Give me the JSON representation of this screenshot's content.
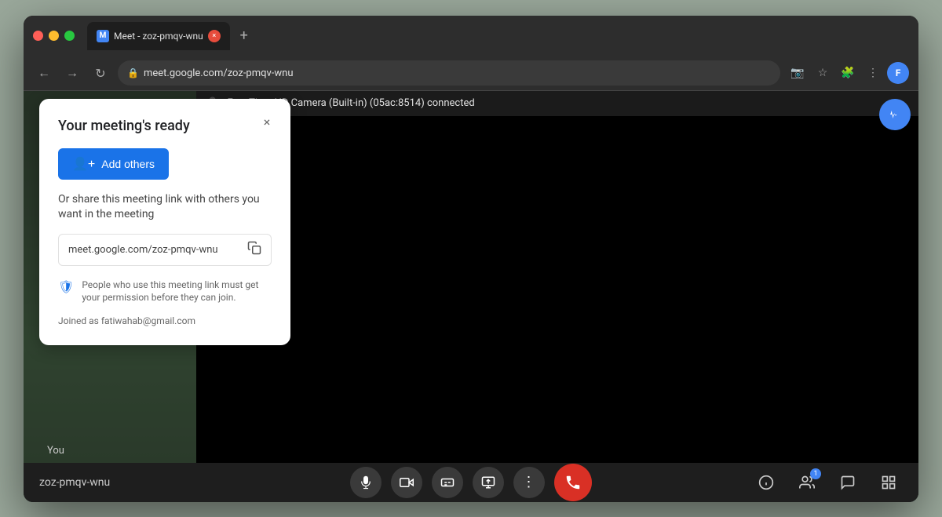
{
  "browser": {
    "tab_title": "Meet - zoz-pmqv-wnu",
    "tab_close_label": "×",
    "new_tab_label": "+",
    "url": "meet.google.com/zoz-pmqv-wnu",
    "nav": {
      "back": "←",
      "forward": "→",
      "refresh": "↻"
    }
  },
  "video": {
    "camera_label": "FaceTime HD Camera (Built-in) (05ac:8514)  connected"
  },
  "popup": {
    "title": "Your meeting's ready",
    "close_label": "×",
    "add_others_label": "Add others",
    "share_text": "Or share this meeting link with others you want in the meeting",
    "meeting_link": "meet.google.com/zoz-pmqv-wnu",
    "security_note": "People who use this meeting link must get your permission before they can join.",
    "joined_as": "Joined as fatiwahab@gmail.com"
  },
  "bottom_bar": {
    "meeting_id": "zoz-pmqv-wnu",
    "you_label": "You",
    "controls": {
      "mic": "mic",
      "camera": "camera",
      "captions": "captions",
      "present": "present",
      "more": "more",
      "end_call": "end call"
    },
    "right_controls": {
      "info": "ℹ",
      "people_count": "1",
      "chat": "chat",
      "activities": "activities"
    }
  },
  "hud": {
    "waveform": "waveform"
  }
}
